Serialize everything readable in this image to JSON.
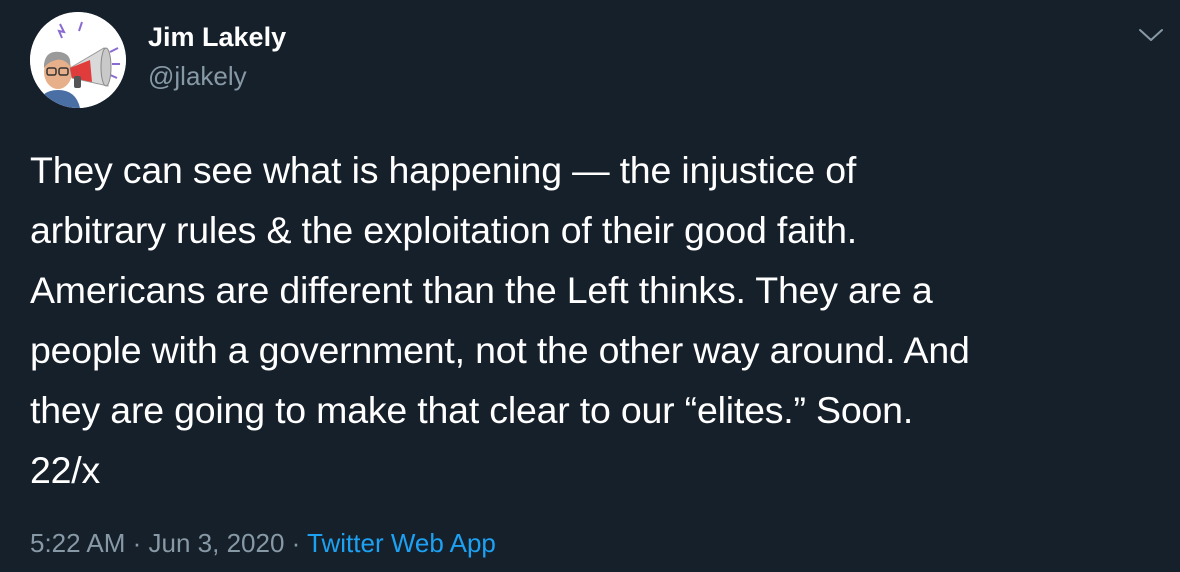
{
  "author": {
    "name": "Jim Lakely",
    "handle": "@jlakely"
  },
  "tweet": {
    "text": "They can see what is happening — the injustice of\narbitrary rules & the exploitation of their good faith.\nAmericans are different than the Left thinks. They are a\npeople with a government, not the other way around. And\nthey are going to make that clear to our “elites.” Soon.\n22/x"
  },
  "meta": {
    "time": "5:22 AM",
    "separator_1": " · ",
    "date": "Jun 3, 2020",
    "separator_2": " · ",
    "source": "Twitter Web App"
  },
  "icons": {
    "avatar": "megaphone-avatar-icon",
    "caret": "chevron-down-icon"
  },
  "colors": {
    "background": "#15202b",
    "text": "#ffffff",
    "secondary": "#8899a6",
    "link": "#1da1f2"
  }
}
